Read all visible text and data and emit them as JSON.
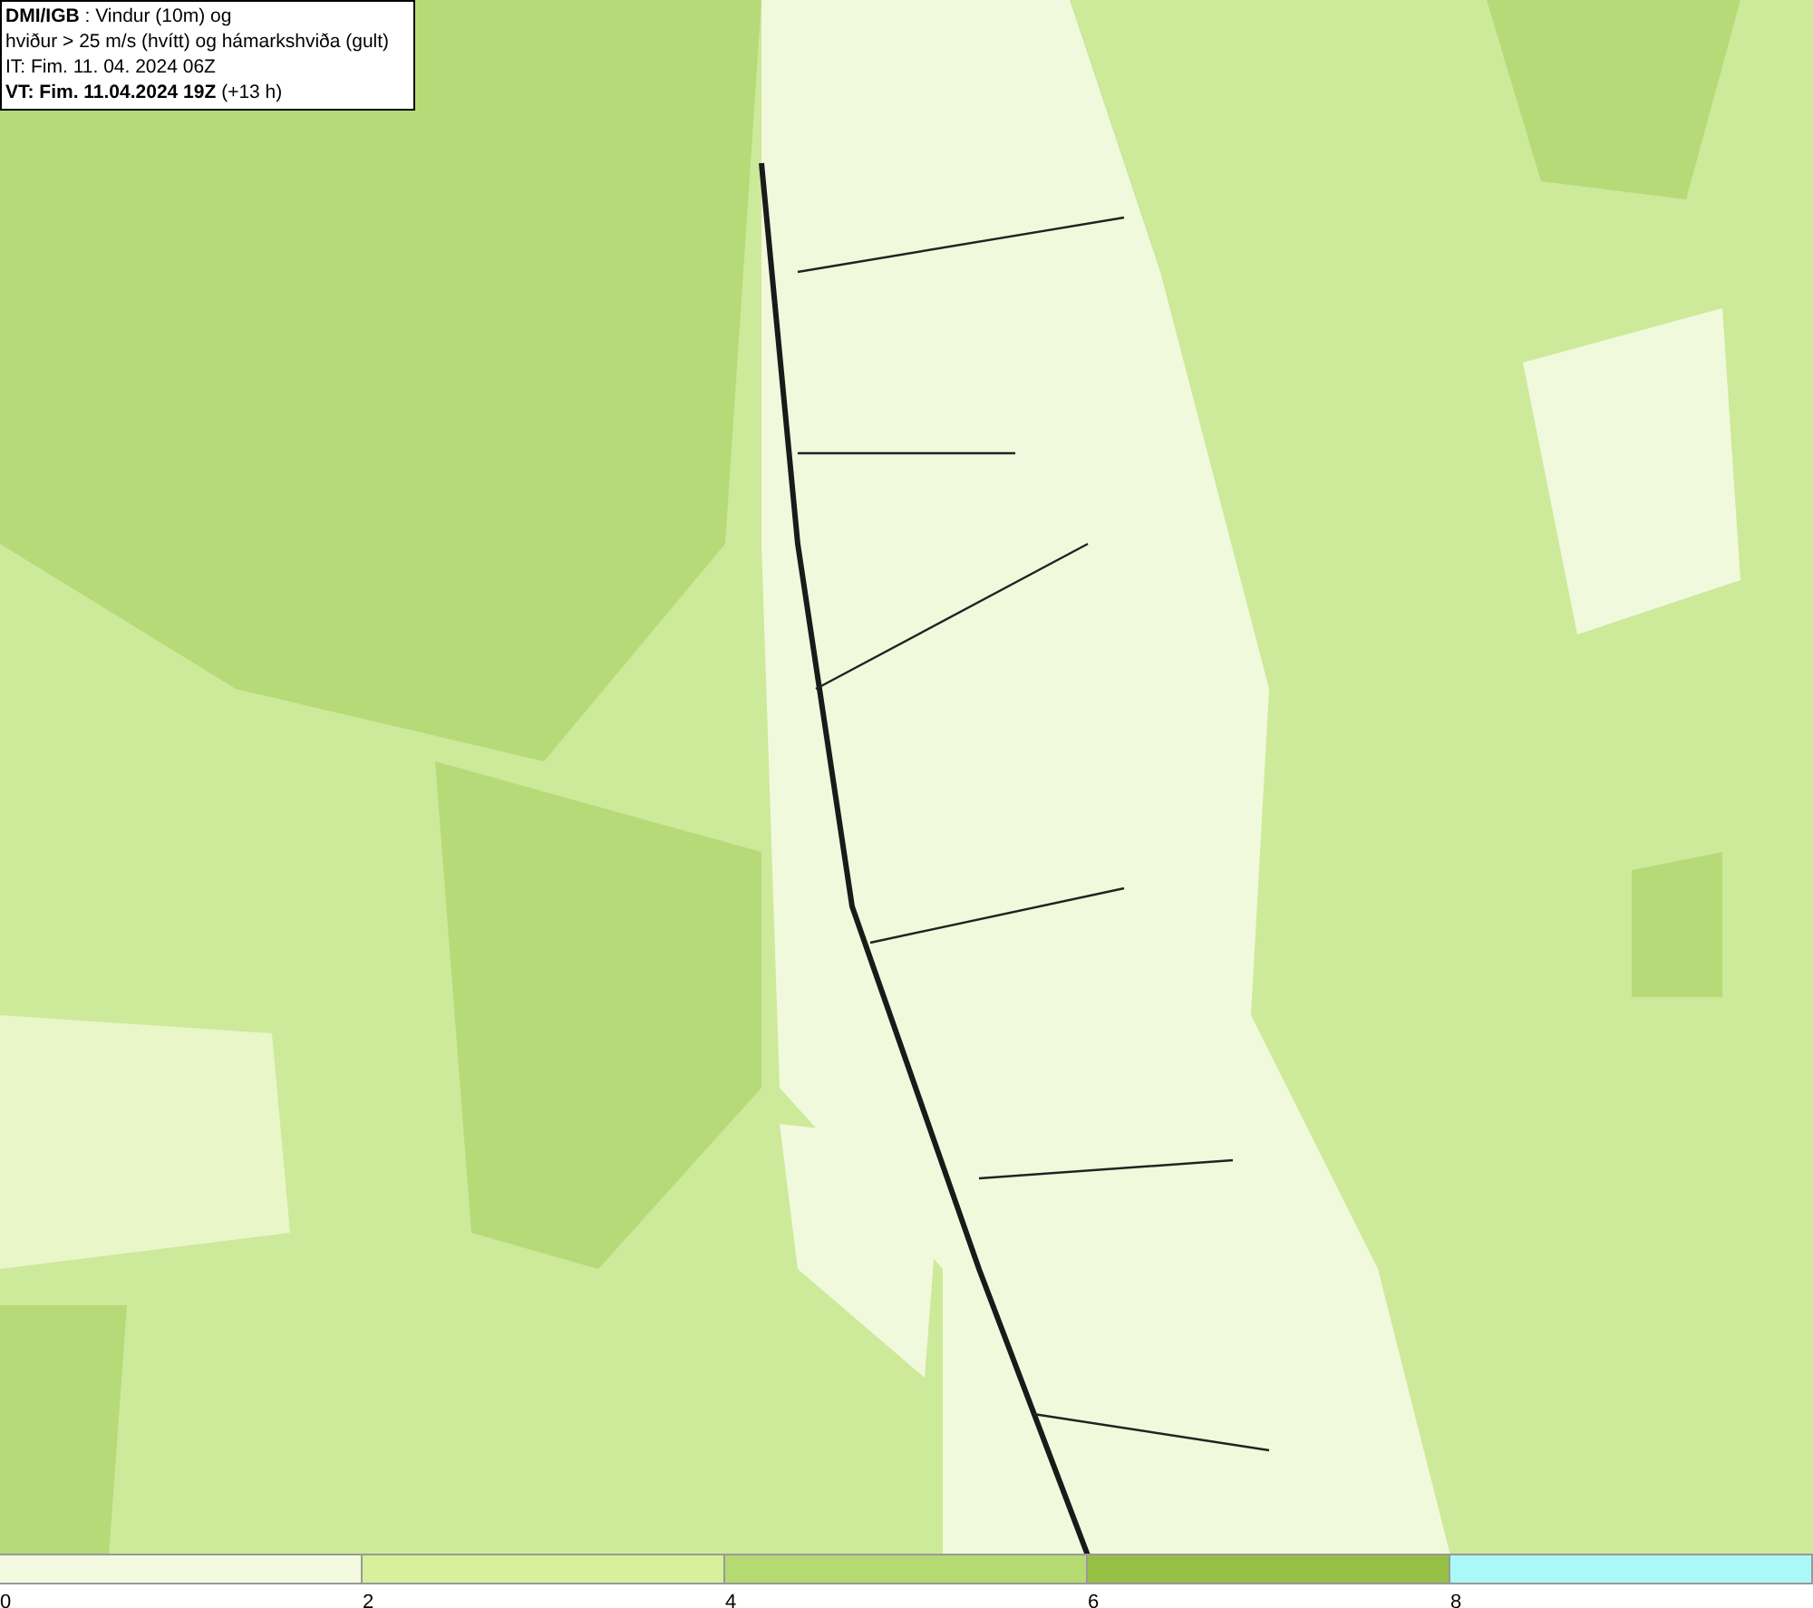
{
  "info_box": {
    "lines": [
      "**DMI/IGB** : Vindur (10m) og",
      "hviður > 25 m/s (hvítt) og hámarkshviða (gult)",
      "IT: Fim. 11. 04. 2024 06Z",
      "**VT: Fim. 11.04.2024 19Z** (+13 h)"
    ]
  },
  "legend": {
    "bins": [
      {
        "color": "#f4fadf"
      },
      {
        "color": "#d6f09c"
      },
      {
        "color": "#b5da72"
      },
      {
        "color": "#96bf45"
      },
      {
        "color": "#aaf8f8"
      }
    ],
    "ticks": [
      "0",
      "2",
      "4",
      "6",
      "8"
    ]
  }
}
